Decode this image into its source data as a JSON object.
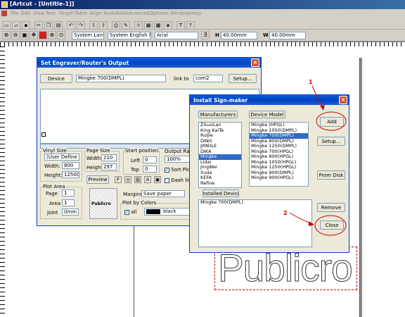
{
  "app": {
    "title": "[Artcut - [Untitle-1]]"
  },
  "menu": [
    "File",
    "Edit",
    "View",
    "Text",
    "Graph",
    "Table",
    "Align",
    "NodeEdit",
    "Advanced",
    "Options",
    "Window",
    "Help"
  ],
  "toolbar": {
    "select_units": "System Lan▾",
    "select_language": "System English for",
    "select_font": "Arial",
    "h_label": "H",
    "h_value": "40.00mm",
    "w_label": "W",
    "w_value": "40.00mm"
  },
  "engraver": {
    "title": "Set Engraver/Router's Output",
    "device_button": "Device",
    "device_value": "Mingke 700(DMPL)",
    "link_to_label": "link to",
    "link_to_value": "com2",
    "setup_button": "Setup...",
    "vinyl_size": {
      "label": "Vinyl Size",
      "value": "(User Define",
      "width_label": "Width:",
      "width_value": "800",
      "height_label": "Height:",
      "height_value": "12500"
    },
    "page_size": {
      "label": "Page Size",
      "width_label": "Width",
      "width_value": "210",
      "height_label": "Height",
      "height_value": "297"
    },
    "start_position": {
      "label": "Start position",
      "left_label": "Left",
      "left_value": "0",
      "top_label": "Top",
      "top_value": "0"
    },
    "output_ratio": {
      "label": "Output Ratio",
      "value": "100%"
    },
    "sort_plotting": "Sort Plotting",
    "dash_line": "Dash lin",
    "plot_area": {
      "label": "Plot Area",
      "page_label": "Page",
      "page_value": "1",
      "area_label": "Area",
      "area_value": "1",
      "joint_label": "Joint",
      "joint_value": "0mm"
    },
    "preview_button": "Preview",
    "preview_thumb_text": "Publicro",
    "margins_label": "Margins",
    "margins_value": "Save paper",
    "plot_by_colors": "Plot by Colors",
    "all_label": "all",
    "color_value": "black"
  },
  "install": {
    "title": "Install Sign-maker",
    "manufacturers_label": "Manufacturers",
    "manufacturers": [
      "ZiLuoLan",
      "King KaiTe",
      "RuiJie",
      "DING",
      "JIMEILE",
      "DIKA",
      "Mingke",
      "Lidai",
      "JingWei",
      "Suda",
      "KEFA",
      "Refine"
    ],
    "manufacturer_selected": 6,
    "device_model_label": "Device Model",
    "models": [
      "Mingke (HPGL)",
      "Mingke 1050(DMPL)",
      "Mingke 700(DMPL)",
      "Mingke 800(DMPL)",
      "Mingke 1250(DMPL)",
      "Mingke 700(HPGL)",
      "Mingke 800(HPGL)",
      "Mingke 1050(HPGL)",
      "Mingke 1250(HPGL)",
      "Mingke 900(DMPL)",
      "Mingke 900(HPGL)"
    ],
    "model_selected": 2,
    "installed_label": "Installed Device",
    "installed": [
      "Mingke 700(DMPL)"
    ],
    "add_button": "Add",
    "setup_button": "Setup...",
    "from_disk_button": "From Disk",
    "remove_button": "Remove",
    "close_button": "Close",
    "annotation_1": "1",
    "annotation_2": "2"
  },
  "canvas": {
    "text": "Publicro"
  },
  "colors": {
    "title_blue": "#0041c4",
    "annotation_red": "#cc0000",
    "dialog_bg": "#ece9d8"
  }
}
